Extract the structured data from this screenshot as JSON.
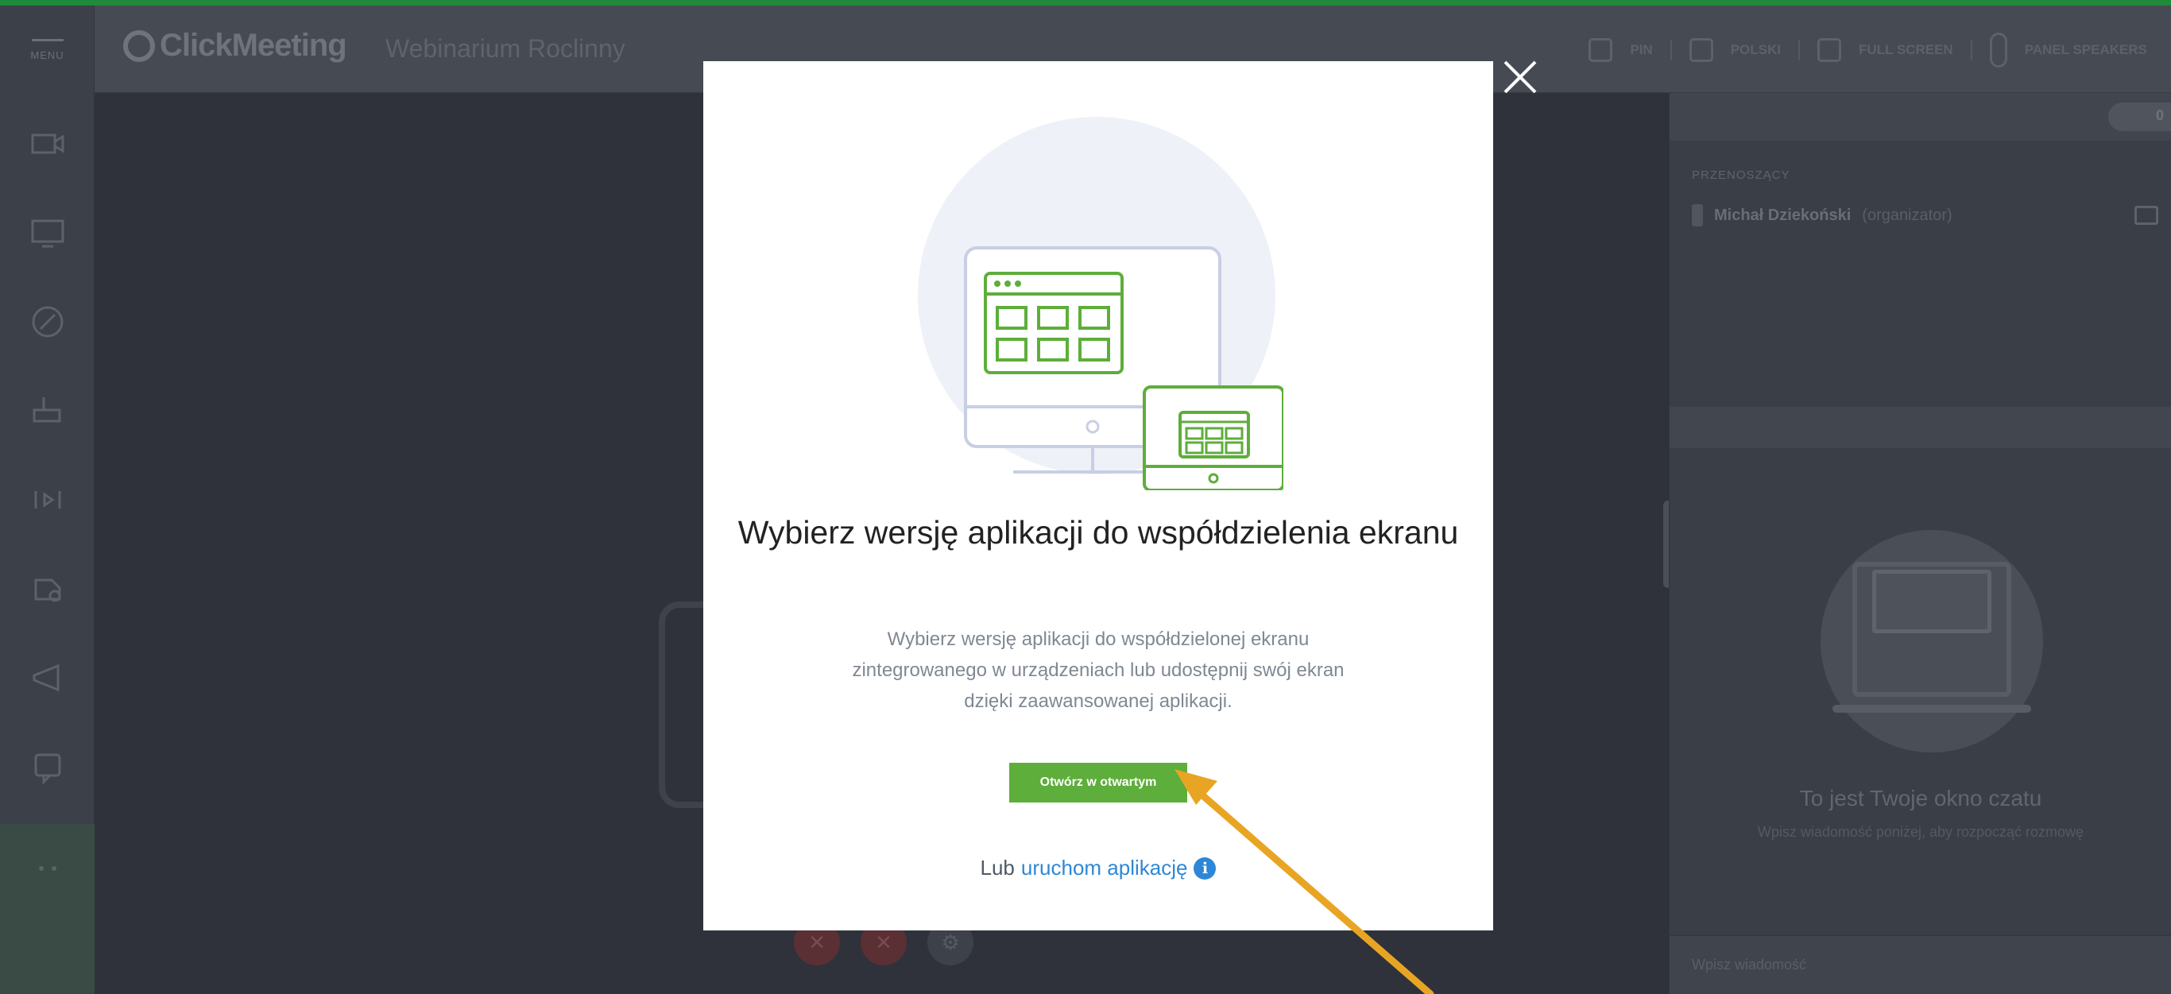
{
  "app": {
    "logo_text": "ClickMeeting",
    "room_title": "Webinarium Roclinny",
    "menu_label": "MENU",
    "accent_color": "#5dae3a",
    "link_color": "#2e87d6"
  },
  "header": {
    "item1": "PIN",
    "item2": "POLSKI",
    "item3": "FULL SCREEN",
    "item4": "PANEL SPEAKERS"
  },
  "sidebar": {
    "icons": [
      "camera-icon",
      "screen-share-icon",
      "whiteboard-icon",
      "presentation-icon",
      "media-icon",
      "apps-icon",
      "megaphone-icon",
      "handout-icon",
      "more-icon"
    ]
  },
  "right_panel": {
    "pill_label": "0",
    "presenters_label": "PRZENOSZĄCY",
    "presenter_name": "Michał Dziekoński",
    "presenter_role": "(organizator)",
    "chat_title": "To jest Twoje okno czatu",
    "chat_subtitle": "Wpisz wiadomość poniżej, aby rozpocząć rozmowę",
    "chat_input_placeholder": "Wpisz wiadomość"
  },
  "modal": {
    "title": "Wybierz wersję aplikacji do współdzielenia ekranu",
    "description": "Wybierz wersję aplikacji do współdzielonej ekranu zintegrowanego w urządzeniach lub udostępnij swój ekran dzięki zaawansowanej aplikacji.",
    "primary_button": "Otwórz w otwartym",
    "alt_prefix": "Lub",
    "alt_link": "uruchom aplikację",
    "info_icon": "i",
    "close_icon": "×"
  }
}
